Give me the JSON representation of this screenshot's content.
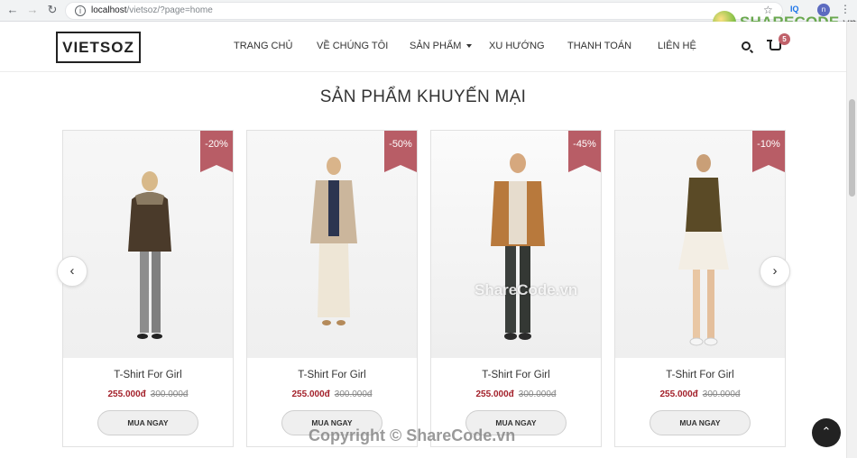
{
  "browser": {
    "url_host": "localhost",
    "url_path": "/vietsoz/?page=home",
    "profile_initial": "n",
    "ext_label": "IQ"
  },
  "brand_watermark": {
    "main": "SHARECODE",
    "suffix": ".vn"
  },
  "header": {
    "logo": "VIETSOZ",
    "menu": [
      "TRANG CHỦ",
      "VỀ CHÚNG TÔI",
      "SẢN PHẨM",
      "XU HƯỚNG",
      "THANH TOÁN",
      "LIÊN HỆ"
    ],
    "cart_count": "5"
  },
  "section": {
    "title": "SẢN PHẨM KHUYẾN MẠI"
  },
  "products": [
    {
      "discount": "-20%",
      "name": "T-Shirt For Girl",
      "price": "255.000đ",
      "old_price": "300.000đ",
      "button": "MUA NGAY"
    },
    {
      "discount": "-50%",
      "name": "T-Shirt For Girl",
      "price": "255.000đ",
      "old_price": "300.000đ",
      "button": "MUA NGAY"
    },
    {
      "discount": "-45%",
      "name": "T-Shirt For Girl",
      "price": "255.000đ",
      "old_price": "300.000đ",
      "button": "MUA NGAY"
    },
    {
      "discount": "-10%",
      "name": "T-Shirt For Girl",
      "price": "255.000đ",
      "old_price": "300.000đ",
      "button": "MUA NGAY"
    }
  ],
  "overlays": {
    "center_watermark": "ShareCode.vn",
    "copyright": "Copyright © ShareCode.vn"
  },
  "icons": [
    "back-arrow-icon",
    "forward-arrow-icon",
    "reload-icon",
    "info-icon",
    "star-icon",
    "search-icon",
    "cart-icon",
    "chevron-left-icon",
    "chevron-right-icon",
    "chevron-up-icon"
  ],
  "colors": {
    "ribbon": "#b85d66",
    "sale_price": "#a3212b",
    "cart_badge": "#c0616a"
  }
}
